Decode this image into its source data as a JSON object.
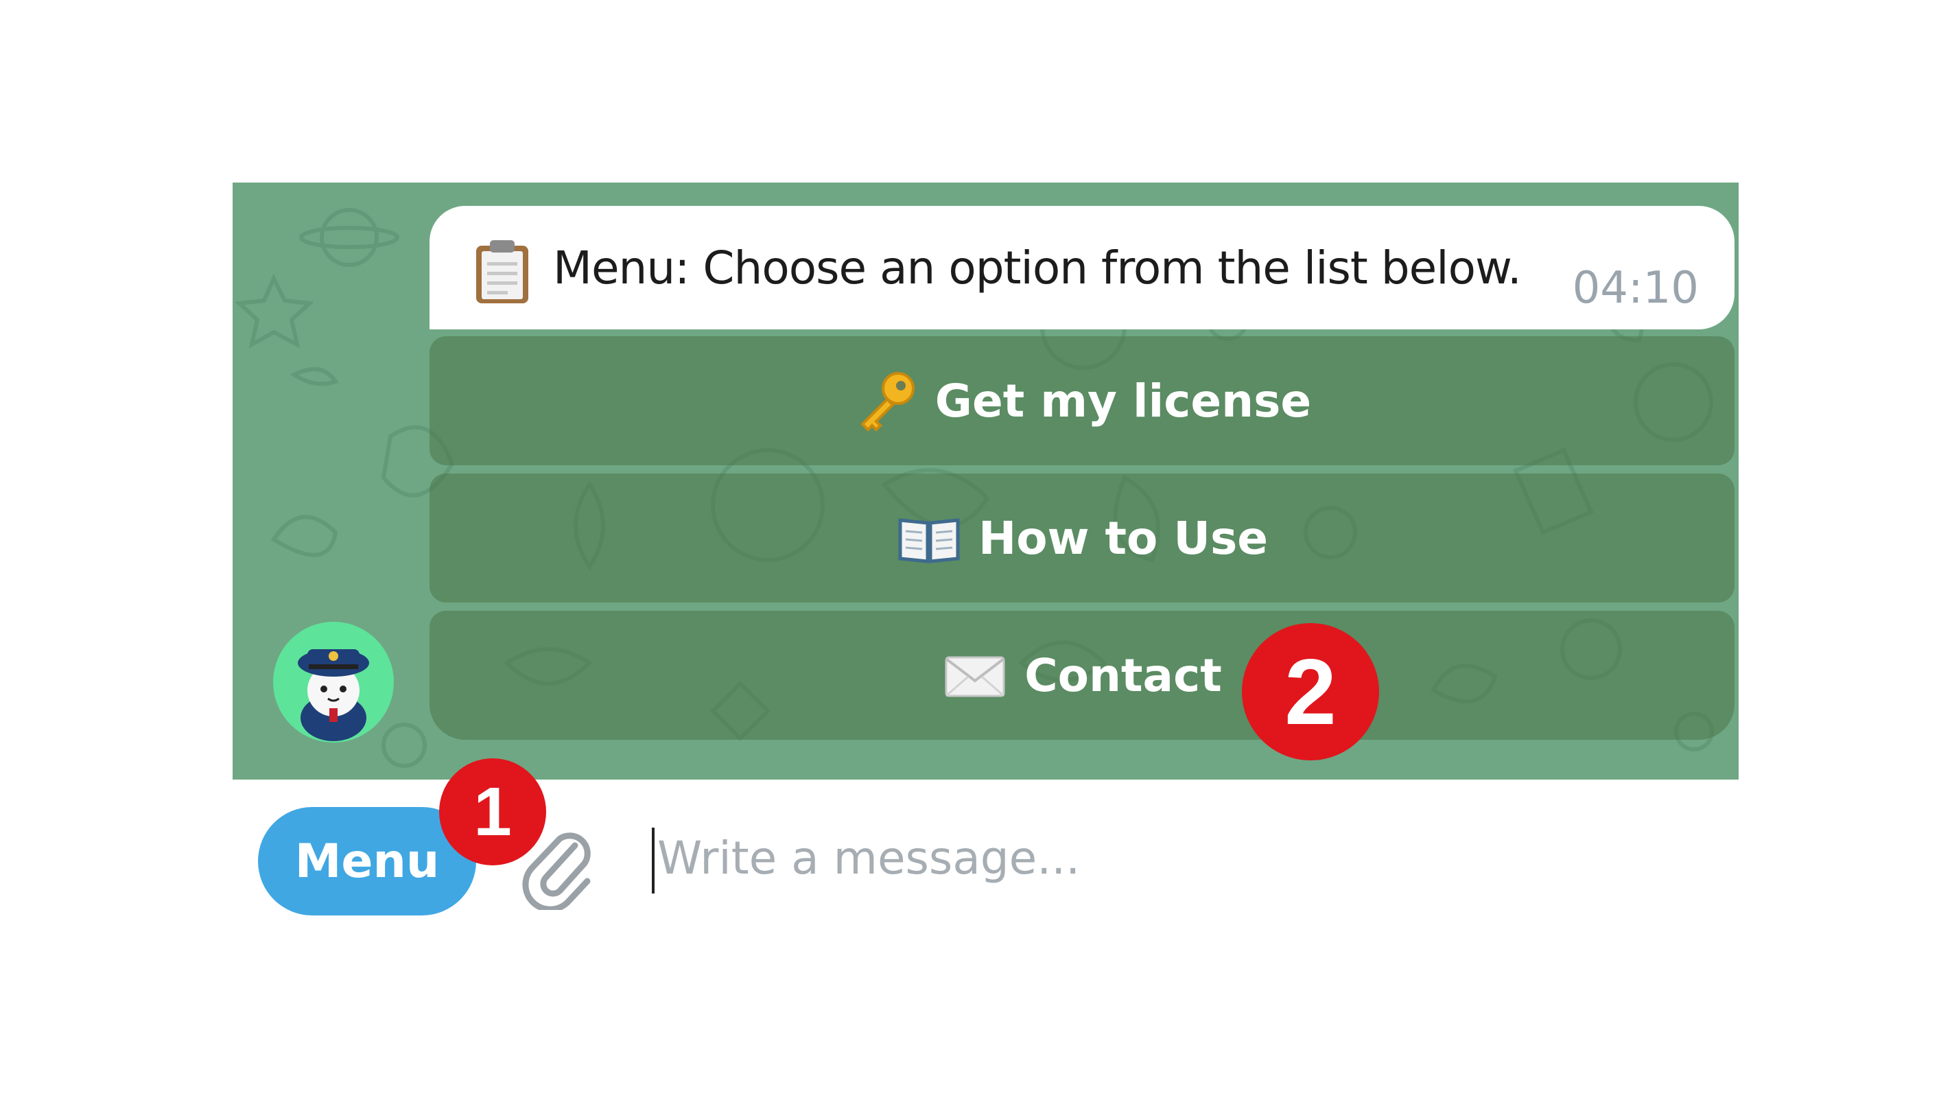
{
  "chat": {
    "message": {
      "icon": "clipboard-icon",
      "text": "Menu: Choose an option from the list below.",
      "time": "04:10"
    },
    "buttons": [
      {
        "icon": "key-icon",
        "label": "Get my license"
      },
      {
        "icon": "book-icon",
        "label": "How to Use"
      },
      {
        "icon": "envelope-icon",
        "label": "Contact"
      }
    ],
    "avatar": "bot-avatar"
  },
  "annotations": {
    "badge_1": "1",
    "badge_2": "2"
  },
  "input_bar": {
    "menu_label": "Menu",
    "attach_icon": "paperclip-icon",
    "placeholder": "Write a message..."
  },
  "colors": {
    "chat_background": "#6fa784",
    "menu_button": "#40a7e3",
    "badge": "#e0161c",
    "bubble": "#ffffff",
    "avatar_background": "#5ee39a"
  }
}
